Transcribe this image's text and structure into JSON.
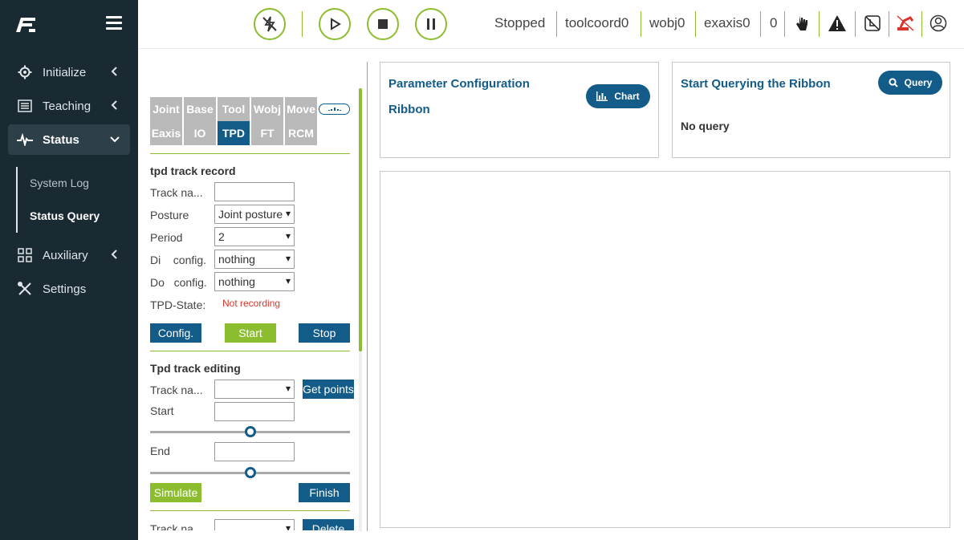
{
  "sidebar": {
    "items": [
      {
        "label": "Initialize",
        "icon": "gear-icon"
      },
      {
        "label": "Teaching",
        "icon": "list-icon"
      },
      {
        "label": "Status",
        "icon": "pulse-icon"
      },
      {
        "label": "Auxiliary",
        "icon": "grid-icon"
      },
      {
        "label": "Settings",
        "icon": "tools-icon"
      }
    ],
    "submenu": [
      "System Log",
      "Status Query"
    ]
  },
  "topbar": {
    "state": "Stopped",
    "tool": "toolcoord0",
    "wobj": "wobj0",
    "exaxis": "exaxis0",
    "count": "0"
  },
  "tabs": {
    "row1": [
      "Joint",
      "Base",
      "Tool",
      "Wobj",
      "Move"
    ],
    "row2": [
      "Eaxis",
      "IO",
      "TPD",
      "FT",
      "RCM"
    ]
  },
  "record": {
    "title": "tpd track record",
    "track_label": "Track na...",
    "track_value": "",
    "posture_label": "Posture",
    "posture_value": "Joint posture",
    "period_label": "Period",
    "period_value": "2",
    "di_label": "Di    config.",
    "di_value": "nothing",
    "do_label": "Do   config.",
    "do_value": "nothing",
    "state_label": "TPD-State:",
    "state_value": "Not recording",
    "config_btn": "Config.",
    "start_btn": "Start",
    "stop_btn": "Stop"
  },
  "editing": {
    "title": "Tpd track editing",
    "track_label": "Track na...",
    "track_value": "",
    "get_points_btn": "Get points",
    "start_label": "Start",
    "start_value": "",
    "start_slider_level": 0.5,
    "end_label": "End",
    "end_value": "",
    "end_slider_level": 0.5,
    "simulate_btn": "Simulate",
    "finish_btn": "Finish",
    "track_label_2": "Track na...",
    "delete_btn": "Delete"
  },
  "param_card": {
    "title_line1": "Parameter Configuration",
    "title_line2": "Ribbon",
    "chart_btn": "Chart"
  },
  "query_card": {
    "title": "Start Querying the Ribbon",
    "query_btn": "Query",
    "status": "No query"
  },
  "colors": {
    "sidebar_bg": "#1a2a33",
    "accent_green": "#8cbd2f",
    "accent_blue": "#135c8a",
    "tab_gray": "#b9b9b9",
    "error_red": "#d9342b"
  }
}
